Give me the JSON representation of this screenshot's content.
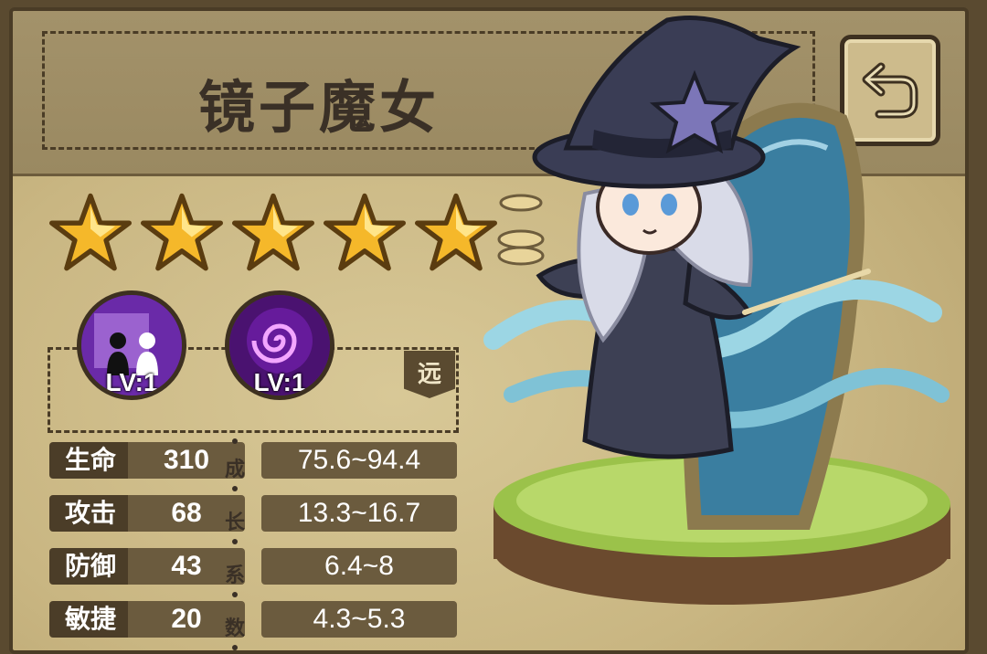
{
  "character": {
    "name": "镜子魔女",
    "star_count": 5,
    "attack_range": "远"
  },
  "skills": [
    {
      "name": "mirror-shadow-skill",
      "level_text": "LV:1"
    },
    {
      "name": "spiral-skill",
      "level_text": "LV:1"
    }
  ],
  "stats": [
    {
      "label": "生命",
      "value": "310",
      "growth": "75.6~94.4"
    },
    {
      "label": "攻击",
      "value": "68",
      "growth": "13.3~16.7"
    },
    {
      "label": "防御",
      "value": "43",
      "growth": "6.4~8"
    },
    {
      "label": "敏捷",
      "value": "20",
      "growth": "4.3~5.3"
    }
  ],
  "growth_label": [
    "成",
    "长",
    "系",
    "数"
  ],
  "icons": {
    "back": "return-arrow-icon",
    "star": "gold-star-icon"
  },
  "colors": {
    "panel": "#c9b682",
    "dark": "#4b3d28",
    "accent": "#f5b82a"
  }
}
